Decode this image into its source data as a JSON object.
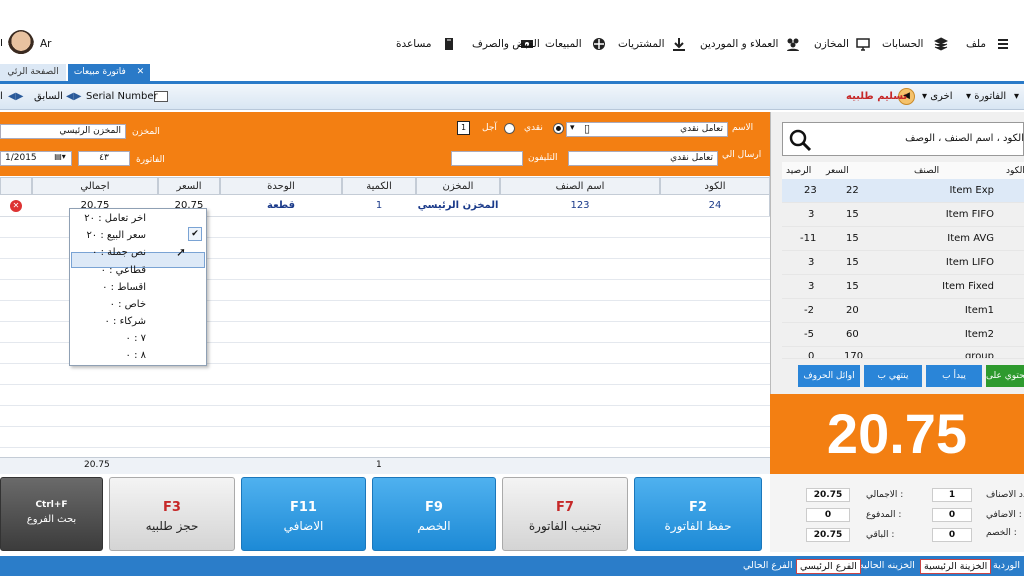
{
  "menubar": {
    "user_initials": "Ar",
    "items": [
      "ملف",
      "الحسابات",
      "المخازن",
      "العملاء و الموردين",
      "المشتريات",
      "المبيعات",
      "القبض والصرف",
      "مساعدة"
    ]
  },
  "tabs": {
    "active": "فاتورة مبيعات",
    "close_glyph": "✕",
    "main": "الصفحة الرئي"
  },
  "toolbar": {
    "invoice": "الفاتورة",
    "other": "اخرى",
    "deliver_order": "تسليم طلبيه",
    "serial_number": "Serial Number",
    "previous": "السابق",
    "pipe": "ا"
  },
  "header": {
    "name_label": "الاسم",
    "name_value": "تعامل نقدي",
    "cash_label": "نقدي",
    "deferred_label": "آجل",
    "page_box": "1",
    "store_label": "المخزن",
    "store_value": "المخزن الرئيسي",
    "send_to_label": "ارسال الي",
    "send_to_value": "تعامل نقدي",
    "phone_label": "التليفون",
    "phone_value": "",
    "invoice_label": "الفاتورة",
    "invoice_value": "٤٣",
    "date_value": "1/2015"
  },
  "grid": {
    "columns": [
      "الكود",
      "اسم الصنف",
      "المخزن",
      "الكمية",
      "الوحدة",
      "السعر",
      "اجمالي"
    ],
    "row": {
      "code": "24",
      "name": "123",
      "store": "المخزن الرئيسي",
      "qty": "1",
      "unit": "قطعة",
      "price": "20.75",
      "total": "20.75"
    },
    "footer_total": "20.75",
    "footer_qty": "1"
  },
  "price_popup": {
    "items": [
      "اخر تعامل : ٢٠",
      "سعر البيع : ٢٠",
      "نص جملة : ٠",
      "قطاعي : ٠",
      "اقساط : ٠",
      "خاص : ٠",
      "شركاء : ٠",
      "٧ : ٠",
      "٨ : ٠"
    ],
    "checked_index": 1,
    "highlighted_index": 2
  },
  "fkeys": [
    {
      "key": "F2",
      "label": "حفظ الفاتورة"
    },
    {
      "key": "F7",
      "label": "تجنيب الفاتورة"
    },
    {
      "key": "F9",
      "label": "الخصم"
    },
    {
      "key": "F11",
      "label": "الاضافي"
    },
    {
      "key": "F3",
      "label": "حجز طلبيه"
    },
    {
      "key": "Ctrl+F",
      "label": "بحث الفروع"
    }
  ],
  "search": {
    "placeholder": "الكود ، اسم الصنف ، الوصف",
    "columns": {
      "code": "الكود",
      "item": "الصنف",
      "price": "السعر",
      "balance": "الرصيد"
    },
    "rows": [
      {
        "item": "Item Exp",
        "price": "22",
        "balance": "23"
      },
      {
        "item": "Item FIFO",
        "price": "15",
        "balance": "3"
      },
      {
        "item": "Item AVG",
        "price": "15",
        "balance": "-11"
      },
      {
        "item": "Item LIFO",
        "price": "15",
        "balance": "3"
      },
      {
        "item": "Item Fixed",
        "price": "15",
        "balance": "3"
      },
      {
        "item": "Item1",
        "price": "20",
        "balance": "-2"
      },
      {
        "item": "Item2",
        "price": "60",
        "balance": "-5"
      },
      {
        "item": "group",
        "price": "170",
        "balance": "0"
      }
    ],
    "filters": {
      "contains": "يحتوي على",
      "starts": "يبدأ ب",
      "ends": "ينتهي ب",
      "initials": "اوائل الحروف"
    }
  },
  "total_display": "20.75",
  "summary": {
    "total_label": "الاجمالي :",
    "total_value": "20.75",
    "paid_label": "المدفوع :",
    "paid_value": "0",
    "remain_label": "الباقي :",
    "remain_value": "20.75",
    "items_label": "عدد الاصناف :",
    "items_value": "1",
    "extra_label": "الاضافي :",
    "extra_value": "0",
    "discount_label": "الخصم :",
    "discount_value": "0"
  },
  "statusbar": {
    "shift": "الوردية",
    "main_treasury": "الخزينة الرئيسية",
    "current_treasury": "الخزينه الحاليه",
    "main_branch": "الفرع الرئيسي",
    "current_branch": "الفرع الحالي"
  },
  "colors": {
    "accent_orange": "#f37f12",
    "fkey_blue": "#2596e0",
    "status_blue": "#2b7dc9"
  }
}
